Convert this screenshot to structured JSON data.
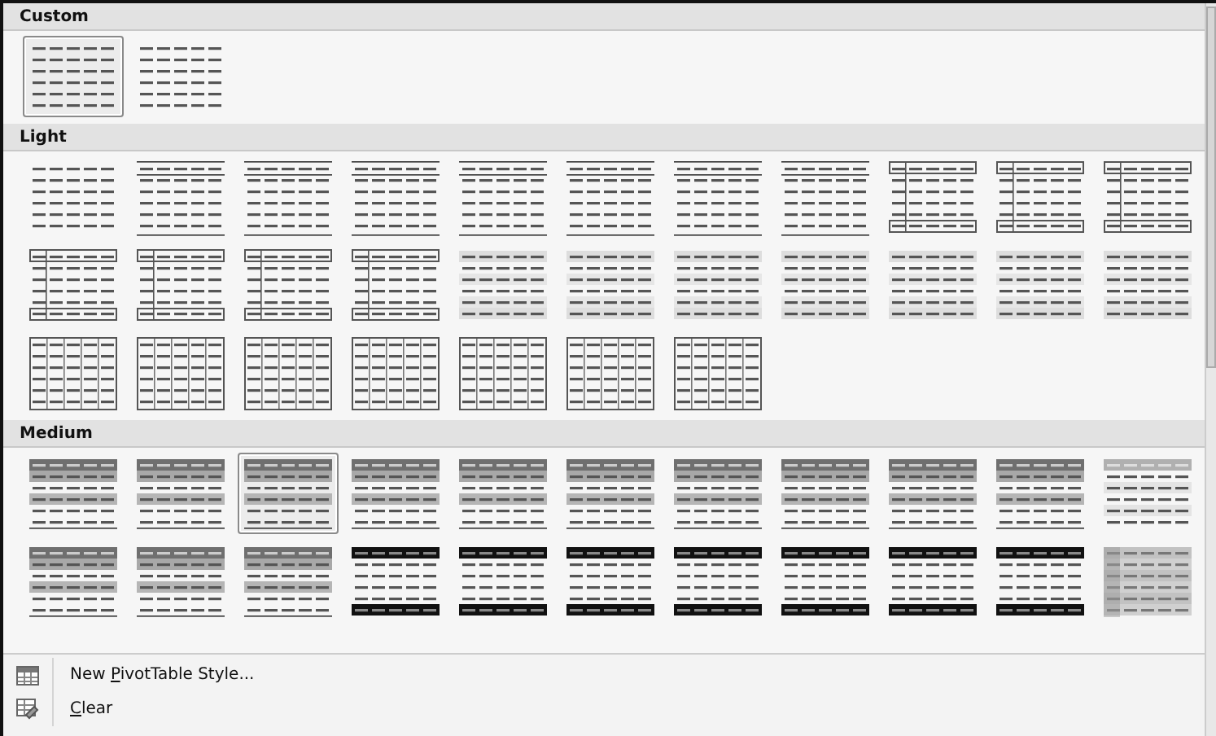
{
  "sections": [
    {
      "title": "Custom",
      "rows": [
        [
          {
            "kind": "plain",
            "selected": true
          },
          {
            "kind": "plain",
            "selected": false
          }
        ]
      ]
    },
    {
      "title": "Light",
      "rows": [
        [
          {
            "kind": "plain",
            "selected": false
          },
          {
            "kind": "lined",
            "selected": false
          },
          {
            "kind": "lined",
            "selected": false
          },
          {
            "kind": "lined",
            "selected": false
          },
          {
            "kind": "lined",
            "selected": false
          },
          {
            "kind": "lined",
            "selected": false
          },
          {
            "kind": "lined",
            "selected": false
          },
          {
            "kind": "lined",
            "selected": false
          },
          {
            "kind": "boxed",
            "selected": false
          },
          {
            "kind": "boxed",
            "selected": false
          },
          {
            "kind": "boxed",
            "selected": false
          }
        ],
        [
          {
            "kind": "boxed",
            "selected": false
          },
          {
            "kind": "boxed",
            "selected": false
          },
          {
            "kind": "boxed",
            "selected": false
          },
          {
            "kind": "boxed",
            "selected": false
          },
          {
            "kind": "banded",
            "selected": false
          },
          {
            "kind": "banded",
            "selected": false
          },
          {
            "kind": "banded",
            "selected": false
          },
          {
            "kind": "banded",
            "selected": false
          },
          {
            "kind": "banded",
            "selected": false
          },
          {
            "kind": "banded",
            "selected": false
          },
          {
            "kind": "banded",
            "selected": false
          }
        ],
        [
          {
            "kind": "grid",
            "selected": false
          },
          {
            "kind": "grid",
            "selected": false
          },
          {
            "kind": "grid",
            "selected": false
          },
          {
            "kind": "grid",
            "selected": false
          },
          {
            "kind": "grid",
            "selected": false
          },
          {
            "kind": "grid",
            "selected": false
          },
          {
            "kind": "grid",
            "selected": false
          }
        ]
      ]
    },
    {
      "title": "Medium",
      "rows": [
        [
          {
            "kind": "header-gray",
            "selected": false
          },
          {
            "kind": "header-gray",
            "selected": false
          },
          {
            "kind": "header-gray",
            "selected": true
          },
          {
            "kind": "header-gray",
            "selected": false
          },
          {
            "kind": "header-gray",
            "selected": false
          },
          {
            "kind": "header-gray",
            "selected": false
          },
          {
            "kind": "header-gray",
            "selected": false
          },
          {
            "kind": "header-gray",
            "selected": false
          },
          {
            "kind": "header-gray",
            "selected": false
          },
          {
            "kind": "header-gray",
            "selected": false
          },
          {
            "kind": "light-header",
            "selected": false
          }
        ],
        [
          {
            "kind": "header-gray",
            "selected": false
          },
          {
            "kind": "header-gray",
            "selected": false
          },
          {
            "kind": "header-gray",
            "selected": false
          },
          {
            "kind": "header-black",
            "selected": false
          },
          {
            "kind": "header-black",
            "selected": false
          },
          {
            "kind": "header-black",
            "selected": false
          },
          {
            "kind": "header-black",
            "selected": false
          },
          {
            "kind": "header-black",
            "selected": false
          },
          {
            "kind": "header-black",
            "selected": false
          },
          {
            "kind": "header-black",
            "selected": false
          },
          {
            "kind": "shaded-column",
            "selected": false
          }
        ]
      ]
    }
  ],
  "menu": [
    {
      "kind": "new-style",
      "before": "New ",
      "key": "P",
      "after": "ivotTable Style..."
    },
    {
      "kind": "clear",
      "key": "C",
      "after": "lear"
    }
  ]
}
